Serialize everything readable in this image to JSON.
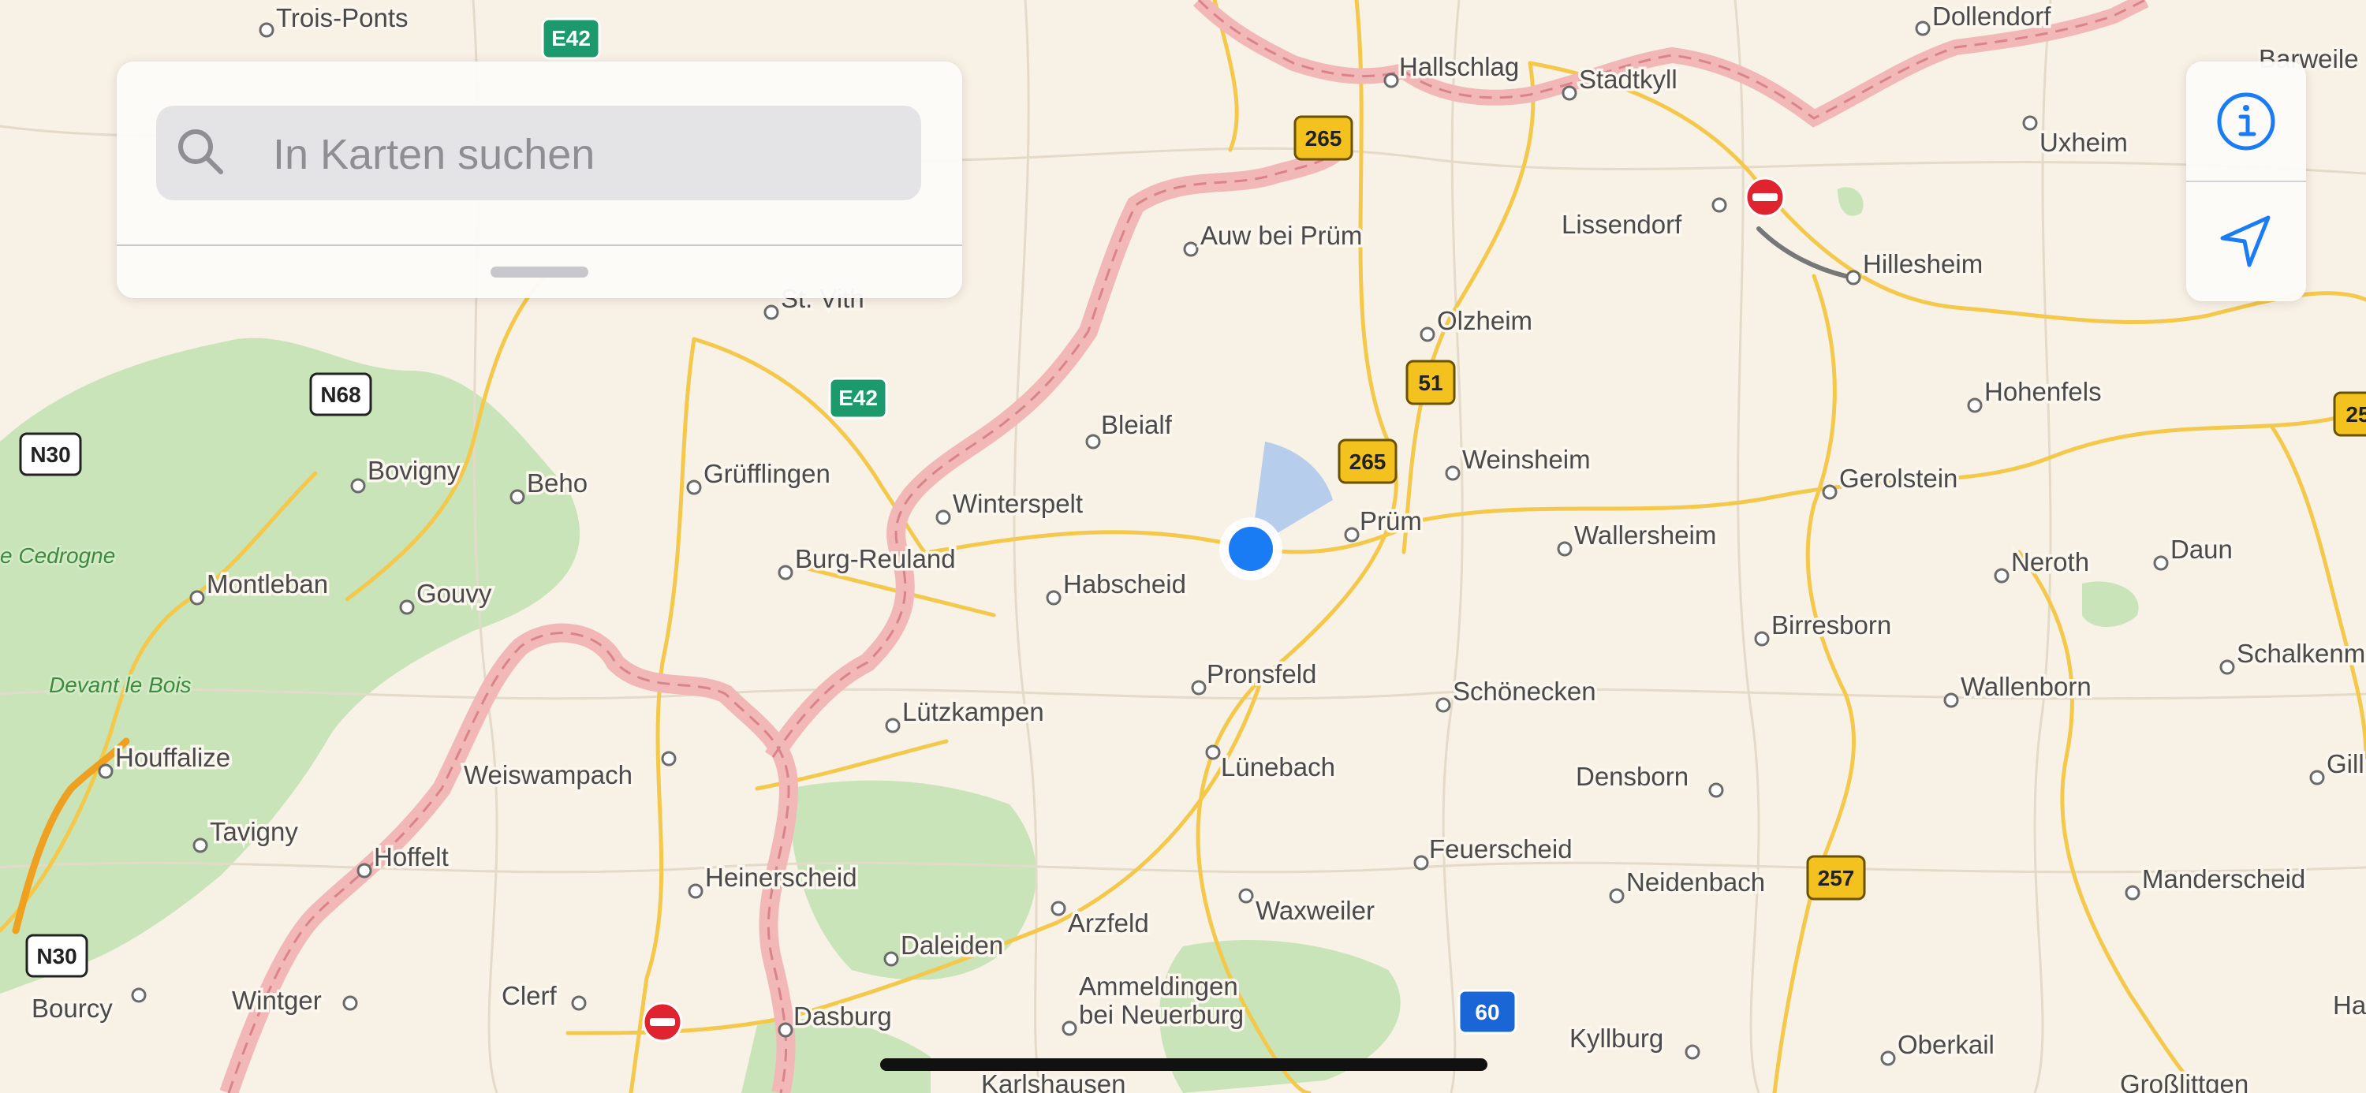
{
  "search": {
    "placeholder": "In Karten suchen",
    "value": ""
  },
  "controls": {
    "info_icon": "info-circle-icon",
    "location_icon": "location-arrow-icon"
  },
  "colors": {
    "accent": "#1a7cf5",
    "forest": "#c9e4b8",
    "border": "#f2b7b7",
    "road": "#f4c84a"
  },
  "map": {
    "places": {
      "trois_ponts": "Trois-Ponts",
      "hallschlag": "Hallschlag",
      "stadtkyll": "Stadtkyll",
      "dollendorf": "Dollendorf",
      "barweiler": "Barweile",
      "uxheim": "Uxheim",
      "lissendorf": "Lissendorf",
      "hillesheim": "Hillesheim",
      "auw": "Auw bei Prüm",
      "st_vith": "St. Vith",
      "olzheim": "Olzheim",
      "bleialf": "Bleialf",
      "hohenfels": "Hohenfels",
      "bovigny": "Bovigny",
      "beho": "Beho",
      "gruefflingen": "Grüfflingen",
      "winterspelt": "Winterspelt",
      "weinsheim": "Weinsheim",
      "gerolstein": "Gerolstein",
      "pruem": "Prüm",
      "wallersheim": "Wallersheim",
      "montleban": "Montleban",
      "gouvy": "Gouvy",
      "burg_reuland": "Burg-Reuland",
      "habscheid": "Habscheid",
      "neroth": "Neroth",
      "daun": "Daun",
      "birresborn": "Birresborn",
      "schalkenmehren": "Schalkenm",
      "pronsfeld": "Pronsfeld",
      "schoenecken": "Schönecken",
      "wallenborn": "Wallenborn",
      "houffalize": "Houffalize",
      "luetzkampen": "Lützkampen",
      "weiswampach": "Weiswampach",
      "luenebach": "Lünebach",
      "densborn": "Densborn",
      "gillenfeld": "Gill",
      "tavigny": "Tavigny",
      "hoffelt": "Hoffelt",
      "heinerscheid": "Heinerscheid",
      "feuerscheid": "Feuerscheid",
      "neidenbach": "Neidenbach",
      "manderscheid": "Manderscheid",
      "arzfeld": "Arzfeld",
      "waxweiler": "Waxweiler",
      "daleiden": "Daleiden",
      "bourcy": "Bourcy",
      "wintger": "Wintger",
      "clerf": "Clerf",
      "ammeldingen_1": "Ammeldingen",
      "ammeldingen_2": "bei Neuerburg",
      "dasburg": "Dasburg",
      "kyllburg": "Kyllburg",
      "oberkail": "Oberkail",
      "grosslittgen": "Großlittgen",
      "karlshausen": "Karlshausen",
      "ha": "Ha"
    },
    "forests": {
      "cedrogne": "e Cedrogne",
      "devant_le_bois": "Devant le Bois"
    },
    "shields": {
      "e42_top": "E42",
      "e42_mid": "E42",
      "b265_top": "265",
      "b265_mid": "265",
      "b51": "51",
      "n68": "N68",
      "n30_top": "N30",
      "n30_bottom": "N30",
      "b257": "257",
      "a60": "60",
      "b25_edge": "25"
    }
  }
}
